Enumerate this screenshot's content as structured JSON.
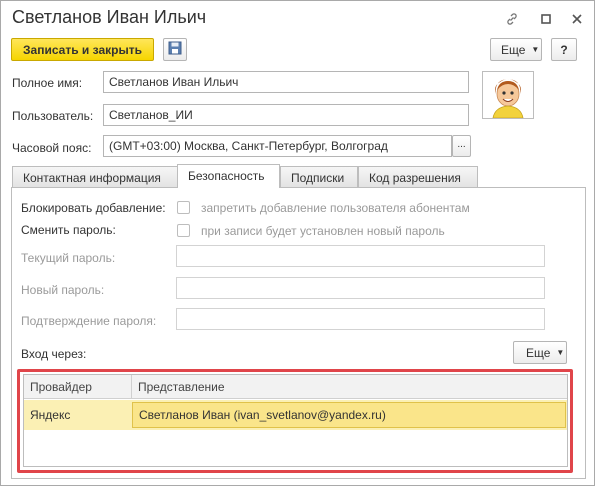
{
  "window": {
    "title": "Светланов Иван Ильич"
  },
  "toolbar": {
    "save_close_label": "Записать и закрыть",
    "more_label": "Еще",
    "help_label": "?"
  },
  "form": {
    "full_name_label": "Полное имя:",
    "full_name_value": "Светланов Иван Ильич",
    "user_label": "Пользователь:",
    "user_value": "Светланов_ИИ",
    "timezone_label": "Часовой пояс:",
    "timezone_value": "(GMT+03:00) Москва, Санкт-Петербург, Волгоград",
    "timezone_button": "..."
  },
  "tabs": [
    {
      "label": "Контактная информация"
    },
    {
      "label": "Безопасность"
    },
    {
      "label": "Подписки"
    },
    {
      "label": "Код разрешения"
    }
  ],
  "security": {
    "block_label": "Блокировать добавление:",
    "block_checkbox_text": "запретить добавление пользователя абонентам",
    "change_pw_label": "Сменить пароль:",
    "change_pw_checkbox_text": "при записи будет установлен новый пароль",
    "current_pw_label": "Текущий пароль:",
    "new_pw_label": "Новый пароль:",
    "confirm_pw_label": "Подтверждение пароля:",
    "login_via_label": "Вход через:",
    "more_label": "Еще"
  },
  "providers_table": {
    "columns": [
      "Провайдер",
      "Представление"
    ],
    "rows": [
      {
        "provider": "Яндекс",
        "representation": "Светланов Иван (ivan_svetlanov@yandex.ru)"
      }
    ]
  }
}
